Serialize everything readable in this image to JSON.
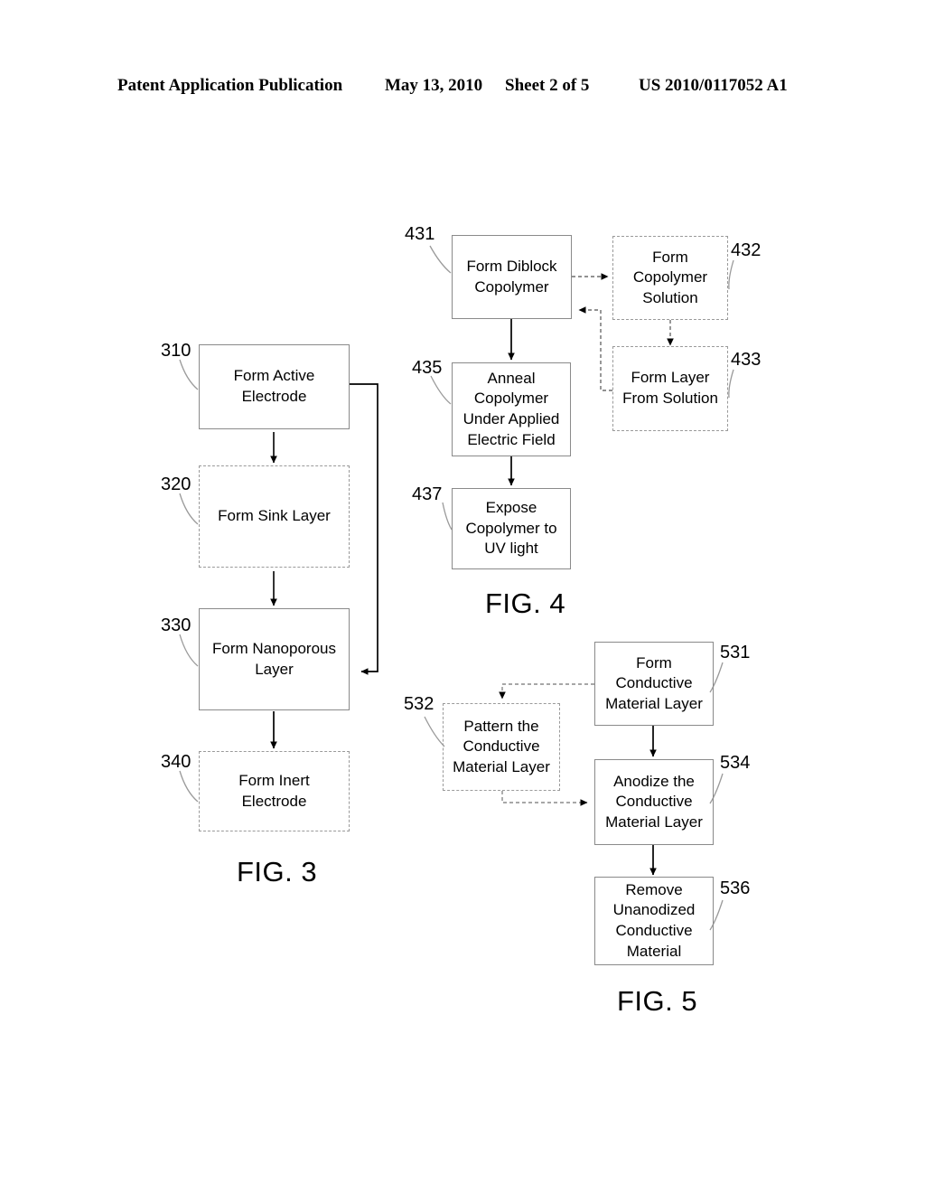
{
  "header": {
    "publication": "Patent Application Publication",
    "date": "May 13, 2010",
    "sheet": "Sheet 2 of 5",
    "patent_number": "US 2010/0117052 A1"
  },
  "figures": [
    {
      "caption": "FIG. 3",
      "boxes": [
        {
          "ref": "310",
          "label": "Form Active\nElectrode",
          "border": "solid"
        },
        {
          "ref": "320",
          "label": "Form Sink Layer",
          "border": "dashed"
        },
        {
          "ref": "330",
          "label": "Form Nanoporous\nLayer",
          "border": "solid"
        },
        {
          "ref": "340",
          "label": "Form Inert\nElectrode",
          "border": "dashed"
        }
      ]
    },
    {
      "caption": "FIG. 4",
      "boxes": [
        {
          "ref": "431",
          "label": "Form Diblock\nCopolymer",
          "border": "solid"
        },
        {
          "ref": "432",
          "label": "Form\nCopolymer\nSolution",
          "border": "dashed"
        },
        {
          "ref": "433",
          "label": "Form Layer\nFrom Solution",
          "border": "dashed"
        },
        {
          "ref": "435",
          "label": "Anneal\nCopolymer\nUnder Applied\nElectric Field",
          "border": "solid"
        },
        {
          "ref": "437",
          "label": "Expose\nCopolymer to\nUV light",
          "border": "solid"
        }
      ]
    },
    {
      "caption": "FIG. 5",
      "boxes": [
        {
          "ref": "531",
          "label": "Form\nConductive\nMaterial Layer",
          "border": "solid"
        },
        {
          "ref": "532",
          "label": "Pattern the\nConductive\nMaterial Layer",
          "border": "dashed"
        },
        {
          "ref": "534",
          "label": "Anodize the\nConductive\nMaterial Layer",
          "border": "solid"
        },
        {
          "ref": "536",
          "label": "Remove\nUnanodized\nConductive\nMaterial",
          "border": "solid"
        }
      ]
    }
  ],
  "fig3": {
    "box310": "Form Active\nElectrode",
    "box320": "Form Sink Layer",
    "box330": "Form Nanoporous\nLayer",
    "box340": "Form Inert\nElectrode",
    "ref310": "310",
    "ref320": "320",
    "ref330": "330",
    "ref340": "340",
    "caption": "FIG. 3"
  },
  "fig4": {
    "box431": "Form Diblock\nCopolymer",
    "box432": "Form\nCopolymer\nSolution",
    "box433": "Form Layer\nFrom Solution",
    "box435": "Anneal\nCopolymer\nUnder Applied\nElectric Field",
    "box437": "Expose\nCopolymer to\nUV light",
    "ref431": "431",
    "ref432": "432",
    "ref433": "433",
    "ref435": "435",
    "ref437": "437",
    "caption": "FIG. 4"
  },
  "fig5": {
    "box531": "Form\nConductive\nMaterial Layer",
    "box532": "Pattern the\nConductive\nMaterial Layer",
    "box534": "Anodize the\nConductive\nMaterial Layer",
    "box536": "Remove\nUnanodized\nConductive\nMaterial",
    "ref531": "531",
    "ref532": "532",
    "ref534": "534",
    "ref536": "536",
    "caption": "FIG. 5"
  },
  "colors": {
    "ink": "#000000",
    "box_border_solid": "#8a8a8a",
    "box_border_dashed": "#9a9a9a",
    "leader_line": "#9a9a9a",
    "page_background": "#ffffff"
  }
}
